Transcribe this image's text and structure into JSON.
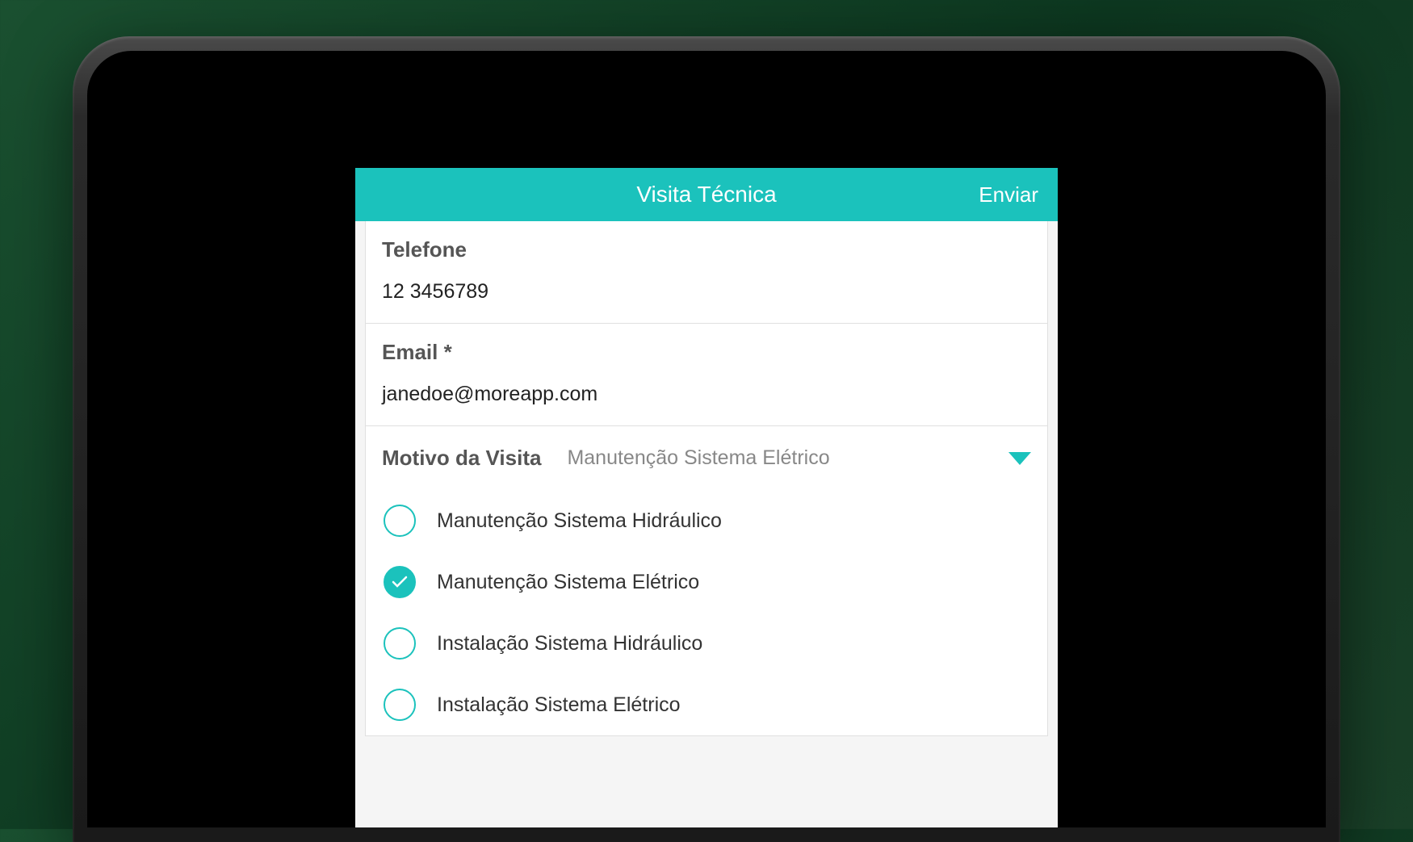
{
  "header": {
    "title": "Visita Técnica",
    "send_button": "Enviar"
  },
  "fields": {
    "telefone": {
      "label": "Telefone",
      "value": "12 3456789"
    },
    "email": {
      "label": "Email *",
      "value": "janedoe@moreapp.com"
    }
  },
  "motivo": {
    "label": "Motivo da Visita",
    "selected": "Manutenção Sistema Elétrico",
    "options": [
      {
        "label": "Manutenção Sistema Hidráulico",
        "checked": false
      },
      {
        "label": "Manutenção Sistema Elétrico",
        "checked": true
      },
      {
        "label": "Instalação Sistema Hidráulico",
        "checked": false
      },
      {
        "label": "Instalação Sistema Elétrico",
        "checked": false
      }
    ]
  },
  "colors": {
    "accent": "#1bc2bc"
  }
}
